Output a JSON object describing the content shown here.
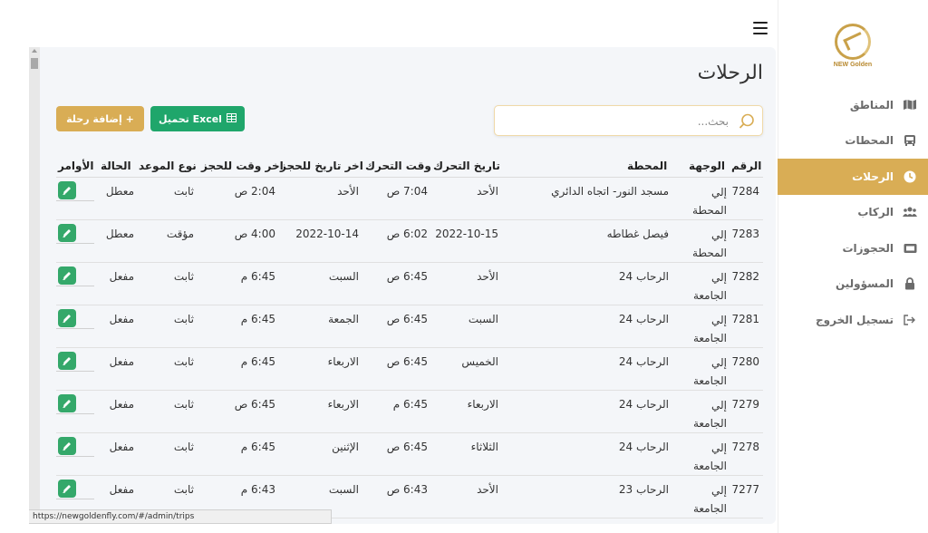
{
  "page_title": "الرحلات",
  "search": {
    "placeholder": "بحث..."
  },
  "buttons": {
    "excel": "تحميل Excel",
    "add": "إضافة رحلة +"
  },
  "brand": {
    "name": "NEW Golden"
  },
  "colors": {
    "accent": "#d9ad55",
    "excel": "#1fa66b",
    "edit": "#34a86a"
  },
  "sidebar": {
    "items": [
      {
        "label": "المناطق",
        "icon": "map-icon",
        "active": false
      },
      {
        "label": "المحطات",
        "icon": "bus-icon",
        "active": false
      },
      {
        "label": "الرحلات",
        "icon": "clock-icon",
        "active": true
      },
      {
        "label": "الركاب",
        "icon": "users-icon",
        "active": false
      },
      {
        "label": "الحجوزات",
        "icon": "ticket-icon",
        "active": false
      },
      {
        "label": "المسؤولين",
        "icon": "lock-icon",
        "active": false
      },
      {
        "label": "تسجيل الخروج",
        "icon": "logout-icon",
        "active": false
      }
    ]
  },
  "table": {
    "headers": {
      "id": "الرقم",
      "destination": "الوجهة",
      "station": "المحطة",
      "move_date": "تاريخ التحرك",
      "move_time": "وقت التحرك",
      "last_book_date": "اخر تاريخ للحجز",
      "last_book_time": "اخر وقت للحجز",
      "schedule_type": "نوع الموعد",
      "status": "الحالة",
      "actions": "الأوامر"
    },
    "rows": [
      {
        "id": "7284",
        "destination": "إلي المحطة",
        "station": "مسجد النور- اتجاه الدائري",
        "move_date": "الأحد",
        "move_time": "7:04 ص",
        "last_book_date": "الأحد",
        "last_book_time": "2:04 ص",
        "schedule_type": "ثابت",
        "status": "معطل"
      },
      {
        "id": "7283",
        "destination": "إلي المحطة",
        "station": "فيصل غطاطه",
        "move_date": "2022-10-15",
        "move_time": "6:02 ص",
        "last_book_date": "2022-10-14",
        "last_book_time": "4:00 ص",
        "schedule_type": "مؤقت",
        "status": "معطل"
      },
      {
        "id": "7282",
        "destination": "إلي الجامعة",
        "station": "الرحاب 24",
        "move_date": "الأحد",
        "move_time": "6:45 ص",
        "last_book_date": "السبت",
        "last_book_time": "6:45 م",
        "schedule_type": "ثابت",
        "status": "مفعل"
      },
      {
        "id": "7281",
        "destination": "إلي الجامعة",
        "station": "الرحاب 24",
        "move_date": "السبت",
        "move_time": "6:45 ص",
        "last_book_date": "الجمعة",
        "last_book_time": "6:45 م",
        "schedule_type": "ثابت",
        "status": "مفعل"
      },
      {
        "id": "7280",
        "destination": "إلي الجامعة",
        "station": "الرحاب 24",
        "move_date": "الخميس",
        "move_time": "6:45 ص",
        "last_book_date": "الاربعاء",
        "last_book_time": "6:45 م",
        "schedule_type": "ثابت",
        "status": "مفعل"
      },
      {
        "id": "7279",
        "destination": "إلي الجامعة",
        "station": "الرحاب 24",
        "move_date": "الاربعاء",
        "move_time": "6:45 م",
        "last_book_date": "الاربعاء",
        "last_book_time": "6:45 ص",
        "schedule_type": "ثابت",
        "status": "مفعل"
      },
      {
        "id": "7278",
        "destination": "إلي الجامعة",
        "station": "الرحاب 24",
        "move_date": "الثلاثاء",
        "move_time": "6:45 ص",
        "last_book_date": "الإثنين",
        "last_book_time": "6:45 م",
        "schedule_type": "ثابت",
        "status": "مفعل"
      },
      {
        "id": "7277",
        "destination": "إلي الجامعة",
        "station": "الرحاب 23",
        "move_date": "الأحد",
        "move_time": "6:43 ص",
        "last_book_date": "السبت",
        "last_book_time": "6:43 م",
        "schedule_type": "ثابت",
        "status": "مفعل"
      }
    ]
  },
  "status_url": "https://newgoldenfly.com/#/admin/trips"
}
